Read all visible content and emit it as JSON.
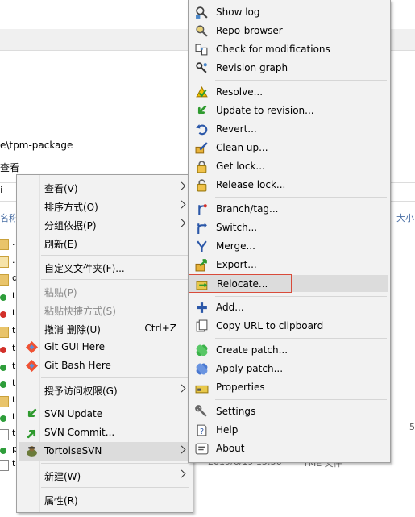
{
  "explorer": {
    "path_text": "e\\tpm-package",
    "menu_text": "查看",
    "addr_char": "i",
    "col_name": "名称",
    "col_size": "大小",
    "row_chars": [
      ".",
      ".",
      "d",
      "t",
      "t",
      "t",
      "t",
      "t",
      "t",
      "t",
      "t",
      "t",
      "t",
      "t",
      "p",
      "t"
    ],
    "date_text": "2019/6/19 15:56",
    "type_text": "TME 文件",
    "side_num": "5"
  },
  "context_menu": {
    "items": [
      {
        "label": "查看(V)",
        "submenu": true
      },
      {
        "label": "排序方式(O)",
        "submenu": true
      },
      {
        "label": "分组依据(P)",
        "submenu": true
      },
      {
        "label": "刷新(E)"
      },
      {
        "label": "自定义文件夹(F)..."
      },
      {
        "label": "粘贴(P)",
        "disabled": true
      },
      {
        "label": "粘贴快捷方式(S)",
        "disabled": true
      },
      {
        "label": "撤消 删除(U)",
        "shortcut": "Ctrl+Z"
      },
      {
        "label": "Git GUI Here",
        "icon": "git-gui-icon"
      },
      {
        "label": "Git Bash Here",
        "icon": "git-bash-icon"
      },
      {
        "label": "授予访问权限(G)",
        "submenu": true
      },
      {
        "label": "SVN Update",
        "icon": "svn-update-icon"
      },
      {
        "label": "SVN Commit...",
        "icon": "svn-commit-icon"
      },
      {
        "label": "TortoiseSVN",
        "icon": "tortoisesvn-icon",
        "submenu": true,
        "highlighted": true
      },
      {
        "label": "新建(W)",
        "submenu": true
      },
      {
        "label": "属性(R)"
      }
    ]
  },
  "svn_menu": {
    "items": [
      {
        "label": "Show log",
        "icon": "show-log-icon"
      },
      {
        "label": "Repo-browser",
        "icon": "repo-browser-icon"
      },
      {
        "label": "Check for modifications",
        "icon": "check-modifications-icon"
      },
      {
        "label": "Revision graph",
        "icon": "revision-graph-icon"
      },
      {
        "label": "Resolve...",
        "icon": "resolve-icon"
      },
      {
        "label": "Update to revision...",
        "icon": "update-revision-icon"
      },
      {
        "label": "Revert...",
        "icon": "revert-icon"
      },
      {
        "label": "Clean up...",
        "icon": "clean-up-icon"
      },
      {
        "label": "Get lock...",
        "icon": "get-lock-icon"
      },
      {
        "label": "Release lock...",
        "icon": "release-lock-icon"
      },
      {
        "label": "Branch/tag...",
        "icon": "branch-tag-icon"
      },
      {
        "label": "Switch...",
        "icon": "switch-icon"
      },
      {
        "label": "Merge...",
        "icon": "merge-icon"
      },
      {
        "label": "Export...",
        "icon": "export-icon"
      },
      {
        "label": "Relocate...",
        "icon": "relocate-icon",
        "highlighted": true
      },
      {
        "label": "Add...",
        "icon": "add-icon"
      },
      {
        "label": "Copy URL to clipboard",
        "icon": "copy-url-icon"
      },
      {
        "label": "Create patch...",
        "icon": "create-patch-icon"
      },
      {
        "label": "Apply patch...",
        "icon": "apply-patch-icon"
      },
      {
        "label": "Properties",
        "icon": "properties-icon"
      },
      {
        "label": "Settings",
        "icon": "settings-icon"
      },
      {
        "label": "Help",
        "icon": "help-icon"
      },
      {
        "label": "About",
        "icon": "about-icon"
      }
    ]
  }
}
